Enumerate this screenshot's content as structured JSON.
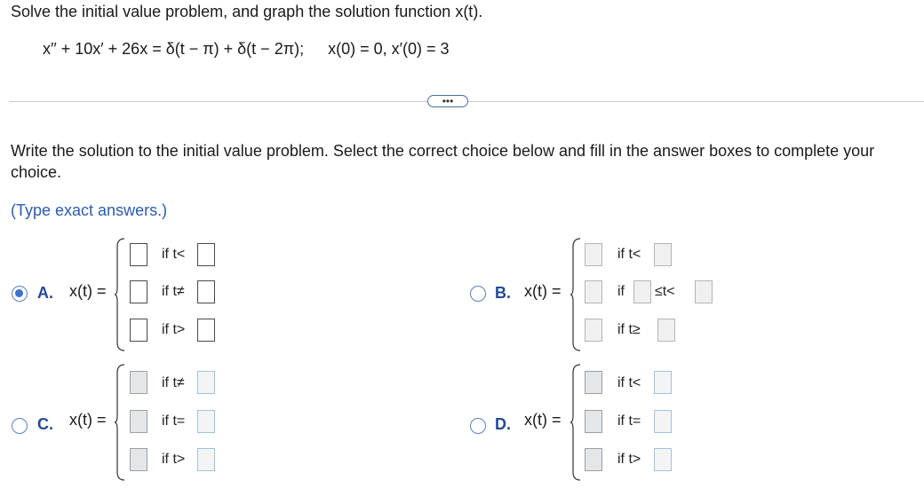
{
  "problem": {
    "instruction": "Solve the initial value problem, and graph the solution function x(t).",
    "equation": "x′′ + 10x′ + 26x = δ(t − π) + δ(t − 2π);",
    "initial_conditions": "x(0) = 0, x′(0) = 3"
  },
  "more_button": {
    "label": "•••"
  },
  "question": {
    "text": "Write the solution to the initial value problem. Select the correct choice below and fill in the answer boxes to complete your choice.",
    "hint": "(Type exact answers.)"
  },
  "choices": [
    {
      "letter": "A.",
      "selected": true,
      "lhs": "x(t) =",
      "rows": [
        {
          "cond": "if t<"
        },
        {
          "cond": "if t≠"
        },
        {
          "cond": "if t>"
        }
      ]
    },
    {
      "letter": "B.",
      "selected": false,
      "lhs": "x(t) =",
      "rows": [
        {
          "cond": "if t<"
        },
        {
          "cond": "if",
          "cond2": "≤t<"
        },
        {
          "cond": "if t≥"
        }
      ]
    },
    {
      "letter": "C.",
      "selected": false,
      "lhs": "x(t) =",
      "rows": [
        {
          "cond": "if t≠"
        },
        {
          "cond": "if t="
        },
        {
          "cond": "if t>"
        }
      ]
    },
    {
      "letter": "D.",
      "selected": false,
      "lhs": "x(t) =",
      "rows": [
        {
          "cond": "if t<"
        },
        {
          "cond": "if t="
        },
        {
          "cond": "if t>"
        }
      ]
    }
  ]
}
